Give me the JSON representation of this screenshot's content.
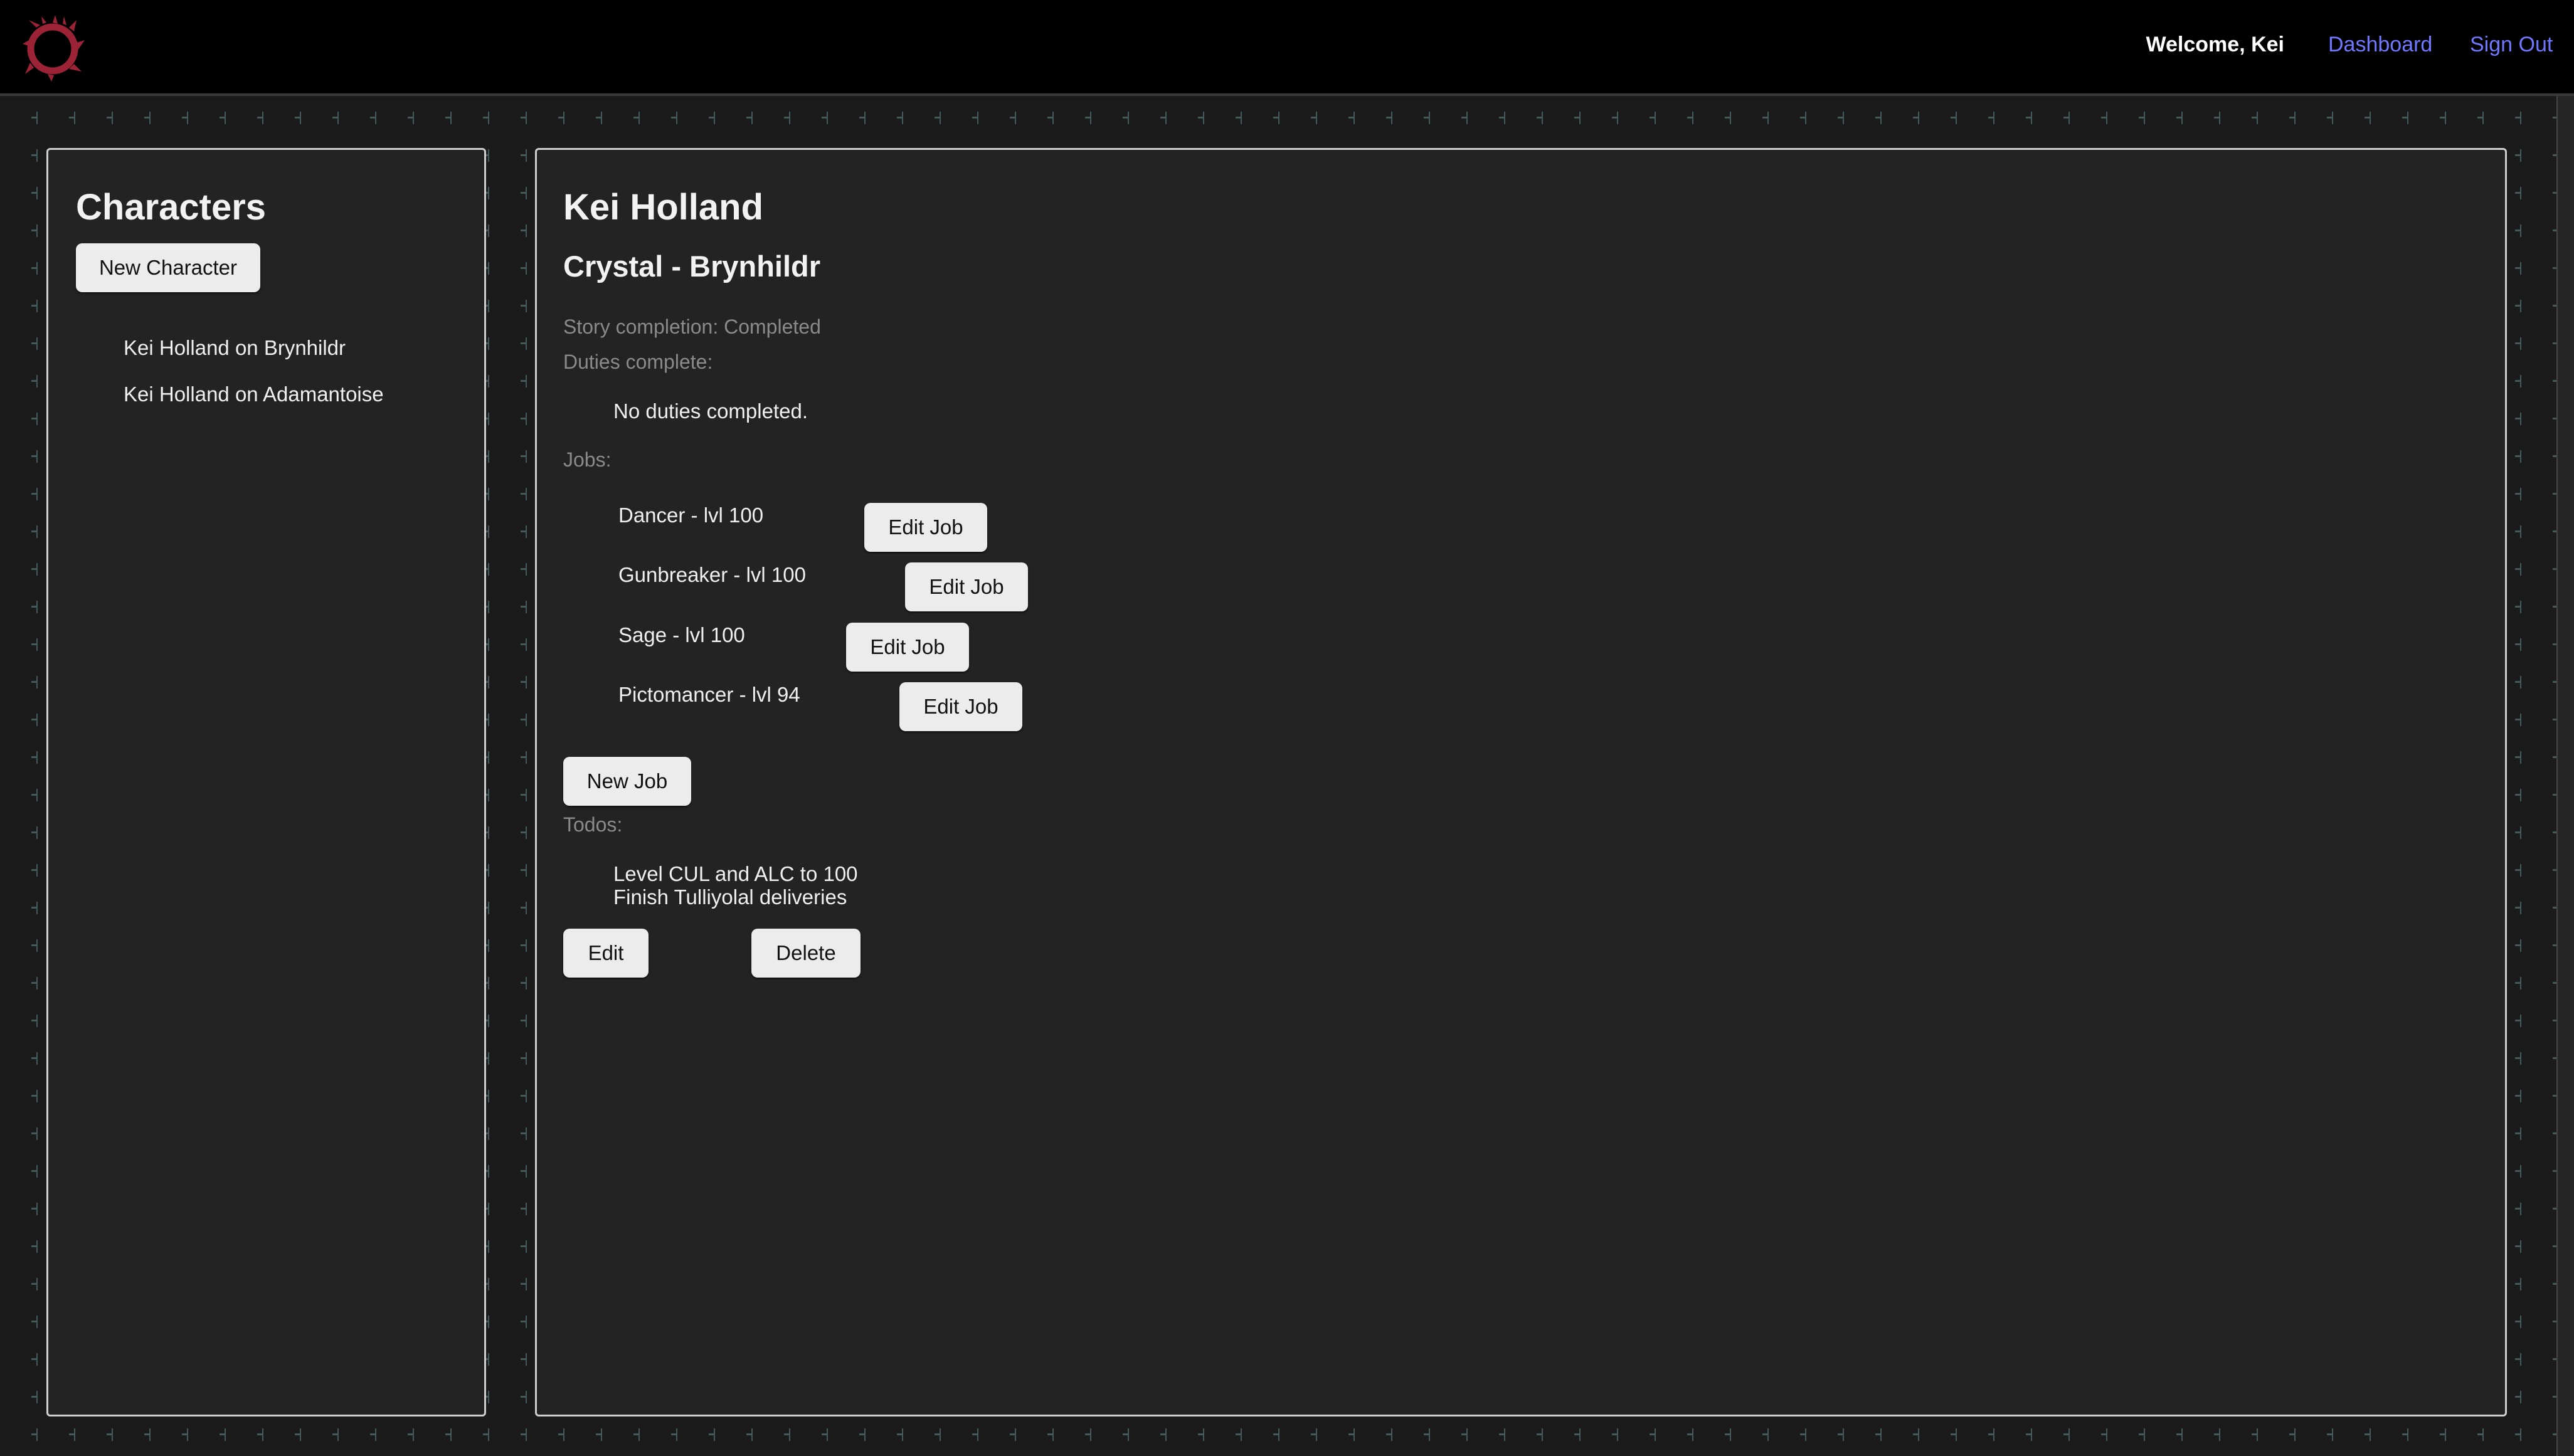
{
  "header": {
    "welcome": "Welcome, Kei",
    "dashboard_label": "Dashboard",
    "signout_label": "Sign Out"
  },
  "sidebar": {
    "title": "Characters",
    "new_character_label": "New Character",
    "characters": [
      "Kei Holland on Brynhildr",
      "Kei Holland on Adamantoise"
    ]
  },
  "main": {
    "name": "Kei Holland",
    "server": "Crystal - Brynhildr",
    "story_completion": "Story completion: Completed",
    "duties_label": "Duties complete:",
    "duties_empty": "No duties completed.",
    "jobs_label": "Jobs:",
    "jobs": [
      {
        "name": "Dancer - lvl 100",
        "edit_label": "Edit Job"
      },
      {
        "name": "Gunbreaker - lvl 100",
        "edit_label": "Edit Job"
      },
      {
        "name": "Sage - lvl 100",
        "edit_label": "Edit Job"
      },
      {
        "name": "Pictomancer - lvl 94",
        "edit_label": "Edit Job"
      }
    ],
    "new_job_label": "New Job",
    "todos_label": "Todos:",
    "todos": [
      "Level CUL and ALC to 100",
      "Finish Tulliyolal deliveries"
    ],
    "edit_label": "Edit",
    "delete_label": "Delete"
  },
  "colors": {
    "topbar": "#000000",
    "background": "#1b1b1b",
    "panel": "#232323",
    "link": "#6f78ff",
    "logo": "#9b2335",
    "plus": "#44595b"
  },
  "icons": {
    "logo": "meteor-logo-icon"
  }
}
